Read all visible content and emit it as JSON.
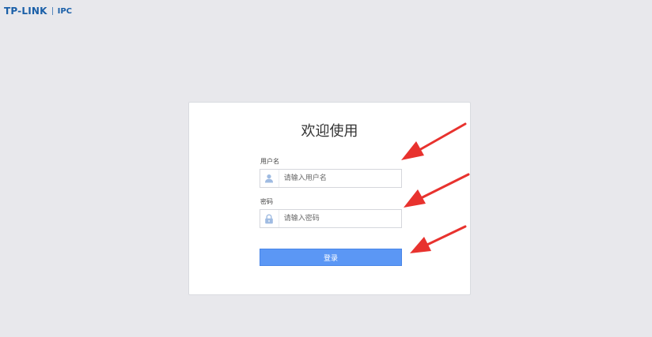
{
  "header": {
    "brand": "TP-LINK",
    "product": "IPC"
  },
  "login": {
    "title": "欢迎使用",
    "username_label": "用户名",
    "username_placeholder": "请输入用户名",
    "password_label": "密码",
    "password_placeholder": "请输入密码",
    "submit_label": "登录"
  },
  "icons": {
    "username": "user-icon",
    "password": "lock-icon"
  },
  "colors": {
    "background": "#e8e8ec",
    "brand": "#1a5fa8",
    "primary_button": "#5b97f5",
    "annotation_arrow": "#e8322e"
  }
}
